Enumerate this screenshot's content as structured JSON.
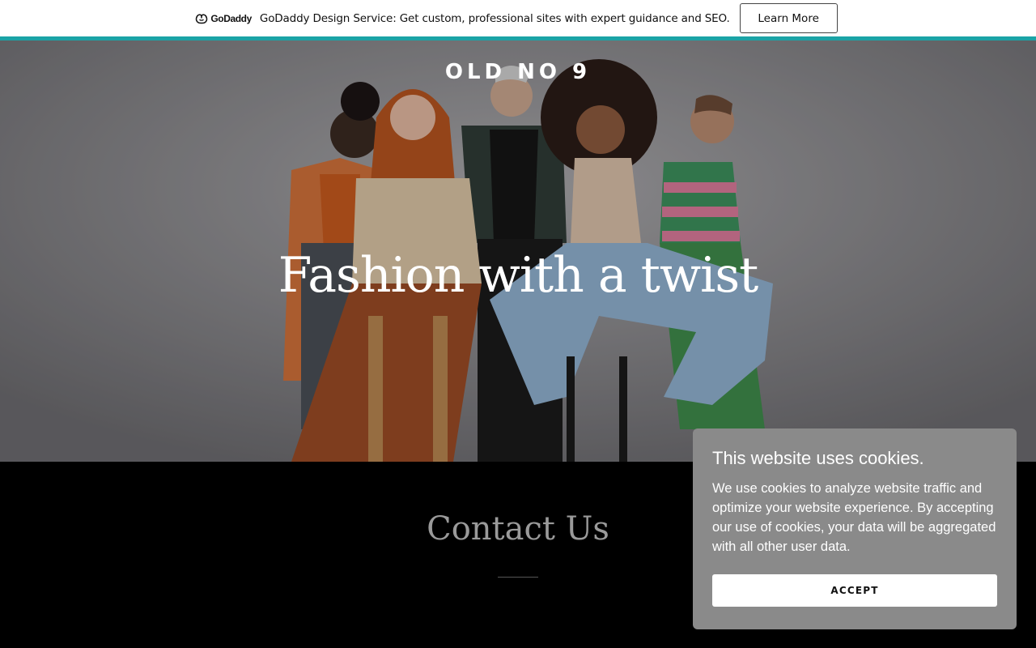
{
  "promo_bar": {
    "logo_text": "GoDaddy",
    "message": "GoDaddy Design Service: Get custom, professional sites with expert guidance and SEO.",
    "button_label": "Learn More",
    "accent_color": "#1ba3a6"
  },
  "hero": {
    "site_title": "OLD NO 9",
    "heading": "Fashion with a twist",
    "image_description_icon": "group-photo-image"
  },
  "contact": {
    "heading": "Contact Us"
  },
  "cookie_banner": {
    "title": "This website uses cookies.",
    "body": "We use cookies to analyze website traffic and optimize your website experience. By accepting our use of cookies, your data will be aggregated with all other user data.",
    "accept_label": "ACCEPT",
    "background_color": "#8a8a8a"
  }
}
